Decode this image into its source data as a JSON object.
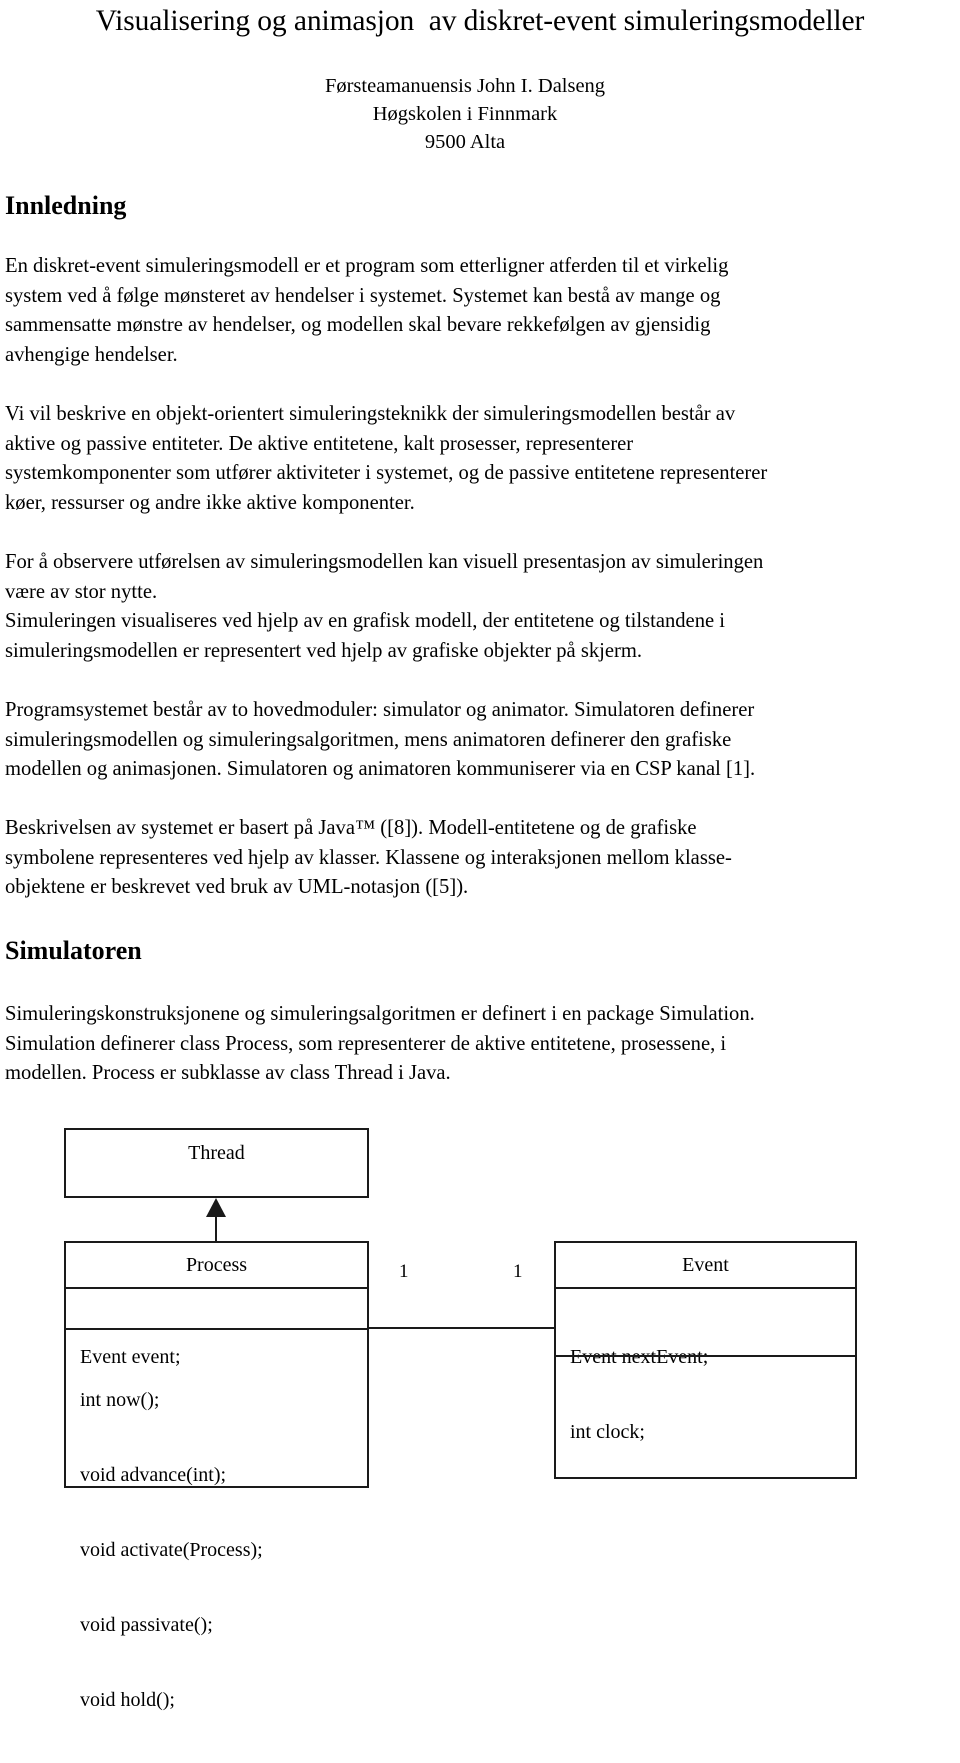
{
  "document": {
    "title": "Visualisering og animasjon  av diskret-event simuleringsmodeller",
    "author": {
      "name": "Førsteamanuensis John I. Dalseng",
      "affiliation": "Høgskolen i Finnmark",
      "location": "9500 Alta"
    },
    "sections": [
      {
        "heading": "Innledning"
      },
      {
        "heading": "Simulatoren"
      }
    ],
    "paragraphs": {
      "p1": {
        "lines": [
          "En diskret-event simuleringsmodell er et program som etterligner atferden til et virkelig",
          "system ved å følge mønsteret av hendelser i systemet. Systemet kan bestå av mange og",
          "sammensatte mønstre av hendelser, og modellen skal bevare rekkefølgen av gjensidig",
          "avhengige hendelser."
        ]
      },
      "p2": {
        "lines": [
          "Vi vil beskrive en objekt-orientert simuleringsteknikk der simuleringsmodellen består av",
          "aktive og passive entiteter. De aktive entitetene, kalt prosesser, representerer",
          "systemkomponenter som utfører aktiviteter i systemet, og de passive entitetene representerer",
          "køer, ressurser og andre ikke aktive komponenter."
        ]
      },
      "p3": {
        "lines": [
          "For å observere utførelsen av simuleringsmodellen kan visuell presentasjon av simuleringen",
          "være av stor nytte.",
          "Simuleringen visualiseres ved hjelp av en grafisk modell, der entitetene og tilstandene i",
          "simuleringsmodellen er representert ved hjelp av grafiske objekter på skjerm."
        ]
      },
      "p4": {
        "lines": [
          "Programsystemet består av to hovedmoduler: simulator og animator. Simulatoren definerer",
          "simuleringsmodellen og simuleringsalgoritmen, mens animatoren definerer den grafiske",
          "modellen og animasjonen. Simulatoren og animatoren kommuniserer via en CSP kanal [1]."
        ]
      },
      "p5": {
        "lines": [
          "Beskrivelsen av systemet er basert på Java™ ([8]). Modell-entitetene og de grafiske",
          "symbolene representeres ved hjelp av klasser. Klassene og interaksjonen mellom klasse-",
          "objektene er beskrevet ved bruk av UML-notasjon ([5])."
        ]
      },
      "p6": {
        "lines": [
          "Simuleringskonstruksjonene og simuleringsalgoritmen er definert i en package Simulation.",
          "Simulation definerer class Process, som representerer de aktive entitetene, prosessene, i",
          "modellen. Process er subklasse av class Thread i Java."
        ]
      }
    }
  },
  "uml_diagram": {
    "classes": {
      "thread": {
        "name": "Thread",
        "attributes": "",
        "operations": ""
      },
      "process": {
        "name": "Process",
        "attributes": "Event event;",
        "operations_lines": [
          "int now();",
          "void advance(int);",
          "void activate(Process);",
          "void passivate();",
          "void hold();"
        ]
      },
      "event": {
        "name": "Event",
        "attributes_lines": [
          "Event nextEvent;",
          "int clock;"
        ],
        "operations": ""
      }
    },
    "relationships": {
      "generalization": {
        "from": "Process",
        "to": "Thread"
      },
      "association": {
        "from": "Process",
        "to": "Event",
        "multiplicity_left": "1",
        "multiplicity_right": "1"
      }
    }
  },
  "colors": {
    "text": "#000000",
    "diagram_stroke": "#1a1a1a",
    "page_background": "#ffffff"
  }
}
